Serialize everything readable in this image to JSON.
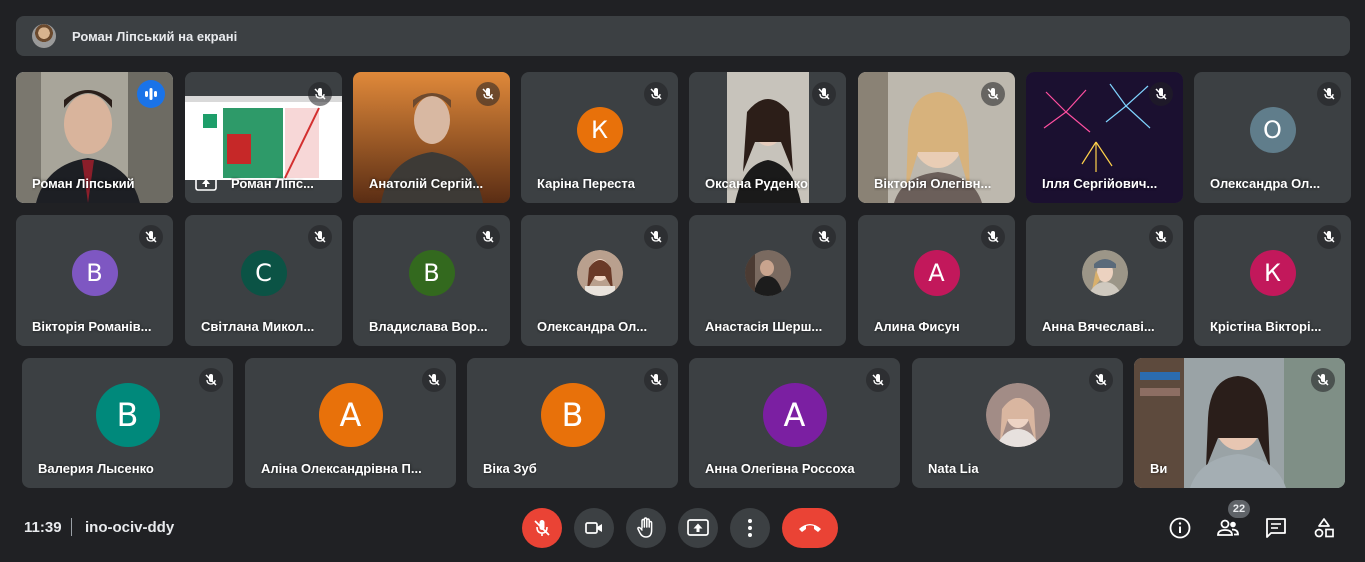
{
  "banner": {
    "text": "Роман Ліпський на екрані"
  },
  "participants": [
    {
      "name": "Роман Ліпський"
    },
    {
      "name": "Роман Ліпс..."
    },
    {
      "name": "Анатолій Сергій..."
    },
    {
      "name": "Каріна Переста",
      "initial": "К"
    },
    {
      "name": "Оксана Руденко"
    },
    {
      "name": "Вікторія Олегівн..."
    },
    {
      "name": "Ілля Сергійович..."
    },
    {
      "name": "Олександра Ол...",
      "initial": "О"
    },
    {
      "name": "Вікторія Романів...",
      "initial": "В"
    },
    {
      "name": "Світлана Микол...",
      "initial": "С"
    },
    {
      "name": "Владислава Вор...",
      "initial": "В"
    },
    {
      "name": "Олександра Ол..."
    },
    {
      "name": "Анастасія Шерш..."
    },
    {
      "name": "Алина Фисун",
      "initial": "А"
    },
    {
      "name": "Анна Вячеславі..."
    },
    {
      "name": "Крістіна Вікторі...",
      "initial": "К"
    },
    {
      "name": "Валерия Лысенко",
      "initial": "В"
    },
    {
      "name": "Аліна Олександрівна П...",
      "initial": "А"
    },
    {
      "name": "Віка Зуб",
      "initial": "В"
    },
    {
      "name": "Анна Олегівна Россоха",
      "initial": "А"
    },
    {
      "name": "Nata Lia"
    },
    {
      "name": "Ви"
    }
  ],
  "colors": {
    "orange": "#e8710a",
    "purple": "#7e57c2",
    "darkgreen": "#0b5345",
    "green": "#33691e",
    "pink": "#c2185b",
    "teal": "#00897b",
    "violet": "#7b1fa2",
    "gray": "#607d8b",
    "red": "#ea4335",
    "blue": "#1a73e8"
  },
  "bottom": {
    "time": "11:39",
    "meeting_code": "ino-ociv-ddy",
    "participants_count": "22"
  },
  "icons": {
    "mic": "mic-off-icon",
    "camera": "videocam-icon",
    "hand": "raise-hand-icon",
    "present": "present-screen-icon",
    "more": "more-vert-icon",
    "end": "call-end-icon",
    "info": "info-icon",
    "people": "people-icon",
    "chat": "chat-icon",
    "activities": "activities-icon"
  }
}
